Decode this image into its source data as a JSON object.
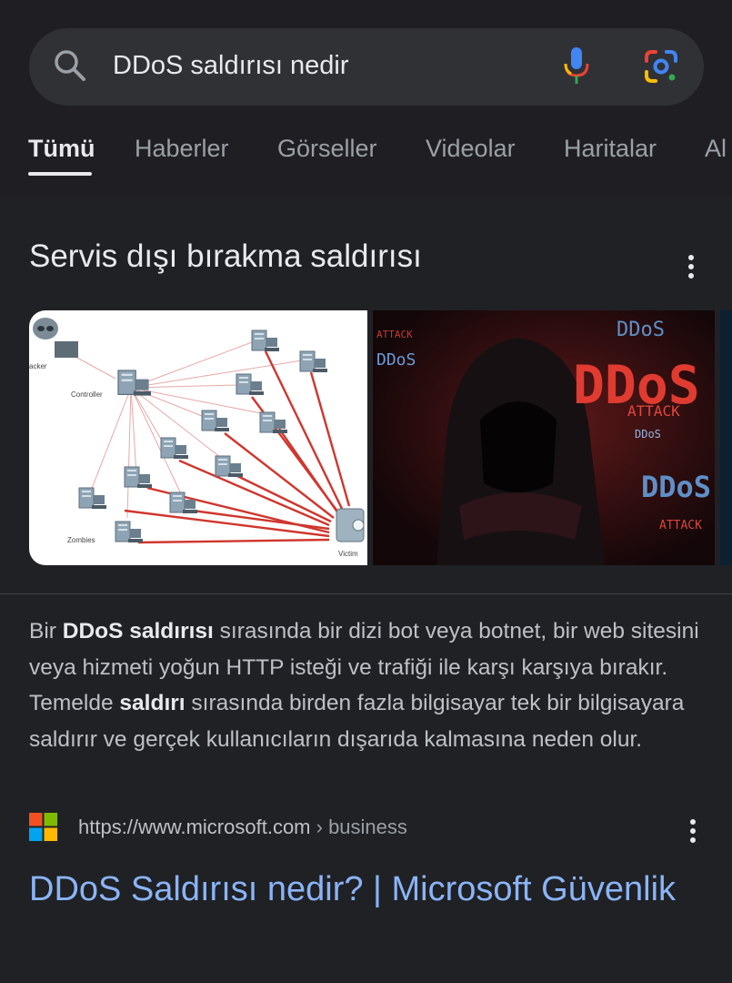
{
  "search": {
    "query": "DDoS saldırısı nedir"
  },
  "tabs": [
    {
      "label": "Tümü",
      "active": true
    },
    {
      "label": "Haberler",
      "active": false
    },
    {
      "label": "Görseller",
      "active": false
    },
    {
      "label": "Videolar",
      "active": false
    },
    {
      "label": "Haritalar",
      "active": false
    },
    {
      "label": "Al",
      "active": false
    }
  ],
  "knowledge_panel": {
    "title": "Servis dışı bırakma saldırısı",
    "image1": {
      "labels": {
        "hacker": "acker",
        "controller": "Controller",
        "zombies": "Zombies",
        "victim": "Victim"
      }
    },
    "image2": {
      "labels": {
        "ddos_big": "DDoS",
        "attack": "ATTACK",
        "ddos_top": "DDoS",
        "ddos_small": "DDoS",
        "ddos_bottom": "DDoS",
        "attack_bottom": "ATTACK",
        "ddos_left": "DDoS",
        "attack_left": "ATTACK"
      }
    }
  },
  "description": {
    "part1": "Bir ",
    "bold1": "DDoS saldırısı",
    "part2": " sırasında bir dizi bot veya botnet, bir web sitesini veya hizmeti yoğun HTTP isteği ve trafiği ile karşı karşıya bırakır. Temelde ",
    "bold2": "saldırı",
    "part3": " sırasında birden fazla bilgisayar tek bir bilgisayara saldırır ve gerçek kullanıcıların dışarıda kalmasına neden olur."
  },
  "source": {
    "url": "https://www.microsoft.com",
    "breadcrumb": " › business"
  },
  "result": {
    "title": "DDoS Saldırısı nedir? | Microsoft Güvenlik"
  }
}
